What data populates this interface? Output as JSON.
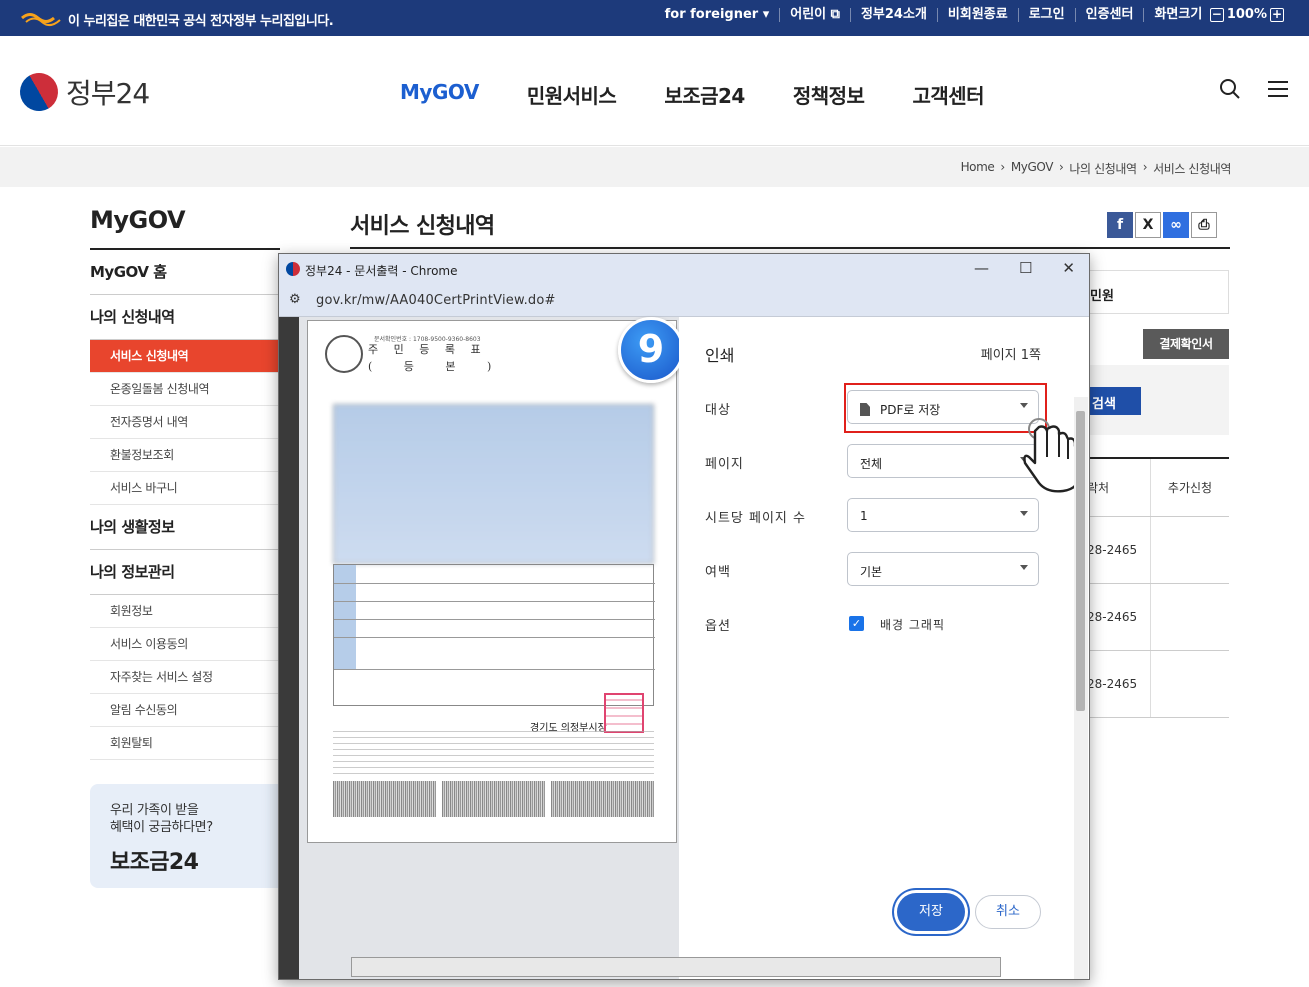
{
  "topbar": {
    "notice": "이 누리집은 대한민국 공식 전자정부 누리집입니다.",
    "utility": [
      "for foreigner",
      "어린이",
      "정부24소개",
      "비회원종료",
      "로그인",
      "인증센터",
      "화면크기"
    ],
    "zoom": "100%"
  },
  "header": {
    "brand": "정부24",
    "nav": [
      "MyGOV",
      "민원서비스",
      "보조금24",
      "정책정보",
      "고객센터"
    ]
  },
  "breadcrumb": [
    "Home",
    "MyGOV",
    "나의 신청내역",
    "서비스 신청내역"
  ],
  "sidebar": {
    "title": "MyGOV",
    "home": "MyGOV 홈",
    "group1": "나의 신청내역",
    "group1_items": [
      "서비스 신청내역",
      "온종일돌봄 신청내역",
      "전자증명서 내역",
      "환불정보조회",
      "서비스 바구니"
    ],
    "group2": "나의 생활정보",
    "group3": "나의 정보관리",
    "group3_items": [
      "회원정보",
      "서비스 이용동의",
      "자주찾는 서비스 설정",
      "알림 수신동의",
      "회원탈퇴"
    ],
    "banner": {
      "line1": "우리 가족이 받을",
      "line2": "혜택이 궁금하다면?",
      "title": "보조금24"
    }
  },
  "main": {
    "title": "서비스 신청내역",
    "box_text": "민원",
    "receipt_button": "결제확인서",
    "search_button": "검색",
    "table_headers": [
      "락처",
      "추가신청"
    ],
    "table_rows": [
      "28-2465",
      "28-2465",
      "28-2465"
    ]
  },
  "popup": {
    "window_title": "정부24 - 문서출력 - Chrome",
    "url": "gov.kr/mw/AA040CertPrintView.do#",
    "step_badge": "9",
    "document": {
      "doc_number": "문서확인번호 : 1708-9500-9360-8603",
      "heading_line1": "주 민 등 록 표",
      "heading_line2": "( 등 본 )",
      "signature": "경기도 의정부시장"
    },
    "print": {
      "title": "인쇄",
      "page_count": "페이지 1쪽",
      "destination_label": "대상",
      "destination_value": "PDF로 저장",
      "pages_label": "페이지",
      "pages_value": "전체",
      "per_sheet_label": "시트당 페이지 수",
      "per_sheet_value": "1",
      "margins_label": "여백",
      "margins_value": "기본",
      "options_label": "옵션",
      "background_graphics": "배경 그래픽",
      "save_button": "저장",
      "cancel_button": "취소"
    }
  },
  "colors": {
    "gov_bar": "#1d3a7b",
    "accent": "#1c5fd0",
    "active_menu": "#e8452d",
    "highlight": "#e0201b"
  }
}
